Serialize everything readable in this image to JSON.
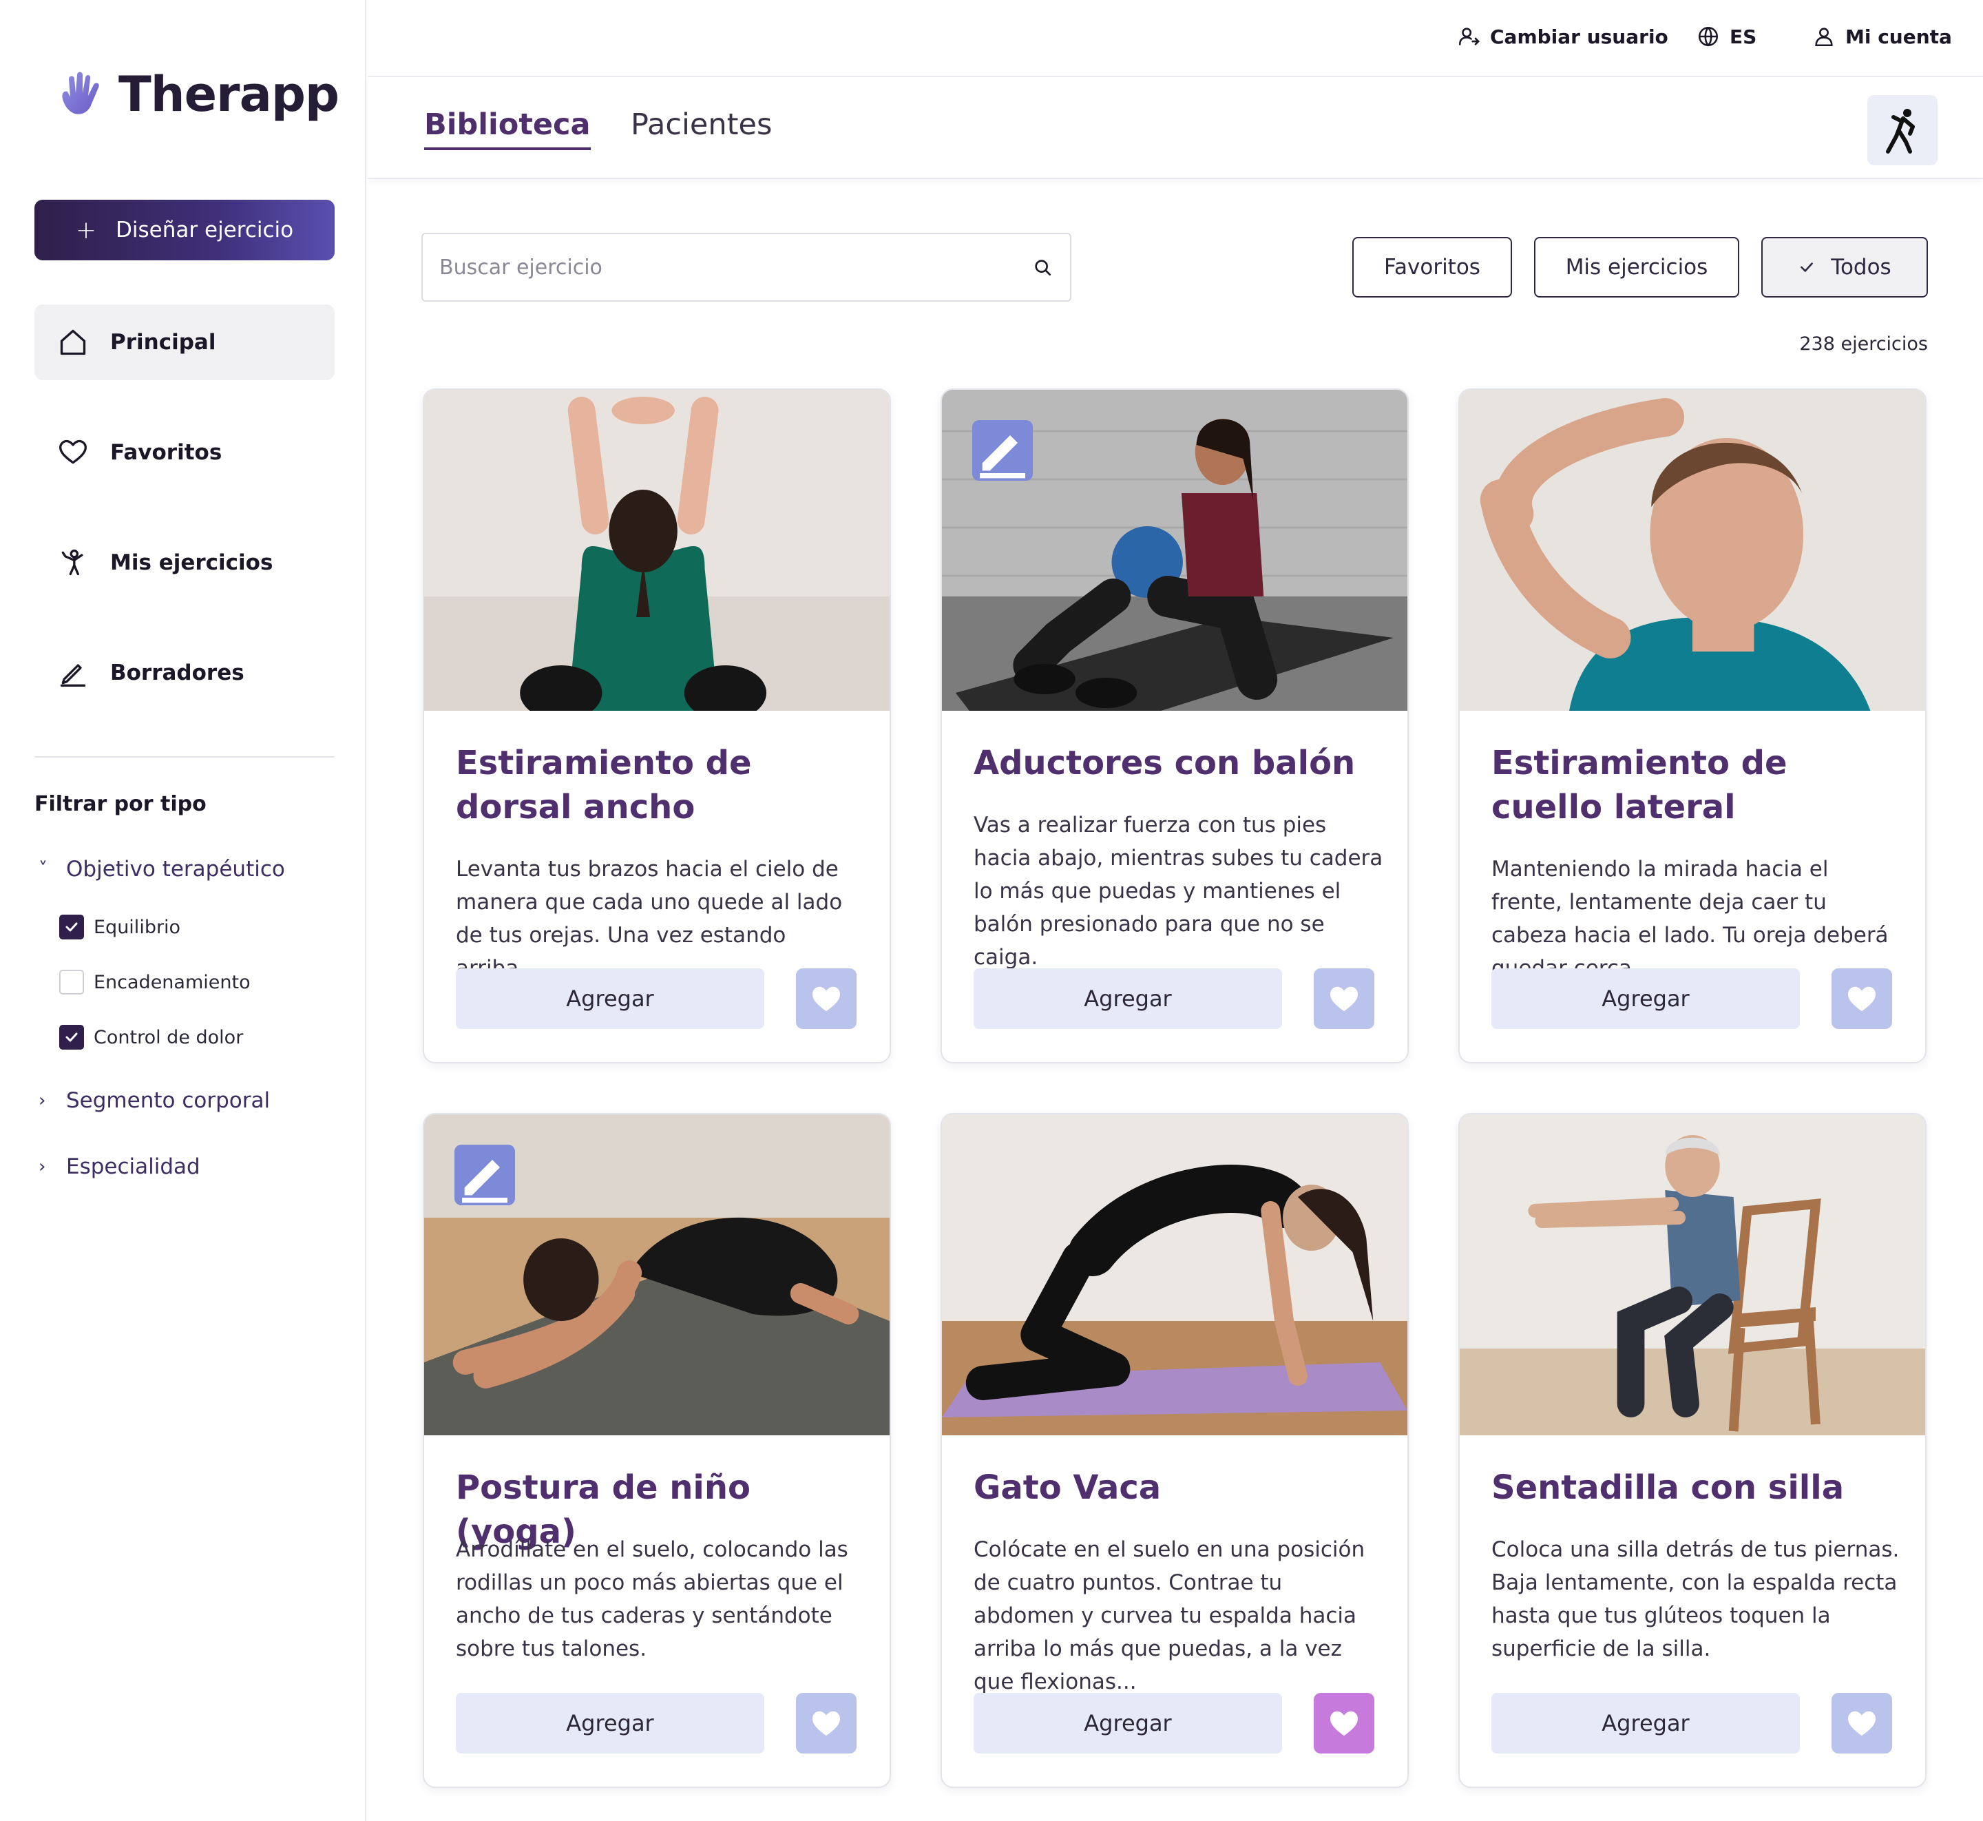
{
  "app": {
    "name": "Therapp"
  },
  "sidebar": {
    "design_button": "Diseñar ejercicio",
    "nav": [
      {
        "label": "Principal",
        "icon": "home-icon",
        "active": true
      },
      {
        "label": "Favoritos",
        "icon": "heart-icon",
        "active": false
      },
      {
        "label": "Mis ejercicios",
        "icon": "person-exercise-icon",
        "active": false
      },
      {
        "label": "Borradores",
        "icon": "pencil-icon",
        "active": false
      }
    ],
    "filter_title": "Filtrar por tipo",
    "accordions": [
      {
        "label": "Objetivo terapéutico",
        "expanded": true,
        "options": [
          {
            "label": "Equilibrio",
            "checked": true
          },
          {
            "label": "Encadenamiento",
            "checked": false
          },
          {
            "label": "Control de dolor",
            "checked": true
          }
        ]
      },
      {
        "label": "Segmento corporal",
        "expanded": false
      },
      {
        "label": "Especialidad",
        "expanded": false
      }
    ]
  },
  "topbar": {
    "switch_user": "Cambiar usuario",
    "language": "ES",
    "account": "Mi cuenta"
  },
  "tabs": [
    {
      "label": "Biblioteca",
      "active": true
    },
    {
      "label": "Pacientes",
      "active": false
    }
  ],
  "search": {
    "placeholder": "Buscar ejercicio",
    "value": ""
  },
  "filters": [
    {
      "label": "Favoritos",
      "selected": false
    },
    {
      "label": "Mis ejercicios",
      "selected": false
    },
    {
      "label": "Todos",
      "selected": true
    }
  ],
  "exercise_count": "238 ejercicios",
  "cards": [
    {
      "title": "Estiramiento de dorsal ancho",
      "description": "Levanta tus brazos hacia el cielo de manera que cada uno quede al lado de tus orejas. Una vez estando arriba...",
      "add_label": "Agregar",
      "editable": false,
      "favorite": false
    },
    {
      "title": "Aductores con balón",
      "description": "Vas a realizar fuerza con tus pies hacia abajo, mientras subes tu cadera lo más que puedas y mantienes el balón presionado para que no se caiga.",
      "add_label": "Agregar",
      "editable": true,
      "favorite": false
    },
    {
      "title": "Estiramiento de cuello lateral",
      "description": "Manteniendo la mirada hacia el frente, lentamente deja caer tu cabeza hacia el lado. Tu oreja deberá quedar cerca...",
      "add_label": "Agregar",
      "editable": false,
      "favorite": false
    },
    {
      "title": "Postura de niño (yoga)",
      "description": "Arrodíllate en el suelo, colocando las rodillas un poco más abiertas que el ancho de tus caderas y sentándote sobre tus talones.",
      "add_label": "Agregar",
      "editable": true,
      "favorite": false
    },
    {
      "title": "Gato Vaca",
      "description": "Colócate en el suelo en una posición de cuatro puntos. Contrae tu abdomen y curvea tu espalda hacia arriba lo más que puedas, a la vez que flexionas...",
      "add_label": "Agregar",
      "editable": false,
      "favorite": true
    },
    {
      "title": "Sentadilla con silla",
      "description": "Coloca una silla detrás de tus piernas. Baja lentamente, con la espalda recta hasta que tus glúteos toquen la superficie de la silla.",
      "add_label": "Agregar",
      "editable": false,
      "favorite": false
    }
  ],
  "colors": {
    "brand": "#4f2f6d",
    "primary_button": "#2f1f4a",
    "add_button_bg": "#e6e9f7",
    "heart_default": "#b9c3ec",
    "heart_favorite": "#c67bdc",
    "edit_badge": "#7c8ad8"
  }
}
